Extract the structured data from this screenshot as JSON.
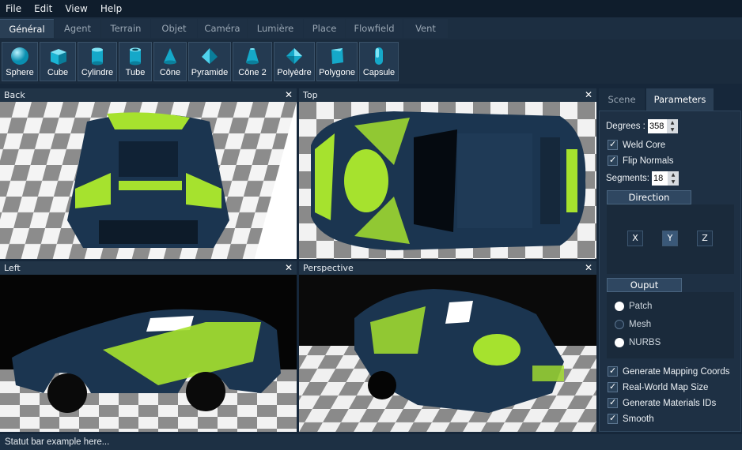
{
  "menu": [
    "File",
    "Edit",
    "View",
    "Help"
  ],
  "tabs": [
    "Général",
    "Agent",
    "Terrain",
    "Objet",
    "Caméra",
    "Lumière",
    "Place",
    "Flowfield",
    "Vent"
  ],
  "active_tab": "Général",
  "toolbar": [
    {
      "label": "Sphere",
      "icon": "sphere-icon"
    },
    {
      "label": "Cube",
      "icon": "cube-icon"
    },
    {
      "label": "Cylindre",
      "icon": "cylinder-icon"
    },
    {
      "label": "Tube",
      "icon": "tube-icon"
    },
    {
      "label": "Cône",
      "icon": "cone-icon"
    },
    {
      "label": "Pyramide",
      "icon": "pyramid-icon"
    },
    {
      "label": "Cône 2",
      "icon": "cone2-icon"
    },
    {
      "label": "Polyèdre",
      "icon": "polyhedron-icon"
    },
    {
      "label": "Polygone",
      "icon": "polygon-icon"
    },
    {
      "label": "Capsule",
      "icon": "capsule-icon"
    }
  ],
  "viewports": [
    {
      "title": "Back",
      "close": "✕"
    },
    {
      "title": "Top",
      "close": "✕"
    },
    {
      "title": "Left",
      "close": "✕"
    },
    {
      "title": "Perspective",
      "close": "✕"
    }
  ],
  "side_tabs": [
    "Scene",
    "Parameters"
  ],
  "active_side_tab": "Parameters",
  "parameters": {
    "degrees_label": "Degrees :",
    "degrees_value": "358",
    "weld_core": {
      "label": "Weld Core",
      "checked": true
    },
    "flip_normals": {
      "label": "Flip Normals",
      "checked": true
    },
    "segments_label": "Segments:",
    "segments_value": "18",
    "direction_label": "Direction",
    "axes": [
      "X",
      "Y",
      "Z"
    ],
    "selected_axis": "Y",
    "output_label": "Ouput",
    "output_options": [
      "Patch",
      "Mesh",
      "NURBS"
    ],
    "options": [
      {
        "label": "Generate Mapping Coords",
        "checked": true
      },
      {
        "label": "Real-World Map Size",
        "checked": true
      },
      {
        "label": "Generate Materials IDs",
        "checked": true
      },
      {
        "label": "Smooth",
        "checked": true
      }
    ]
  },
  "status": "Statut bar example here...",
  "colors": {
    "background": "#16273a",
    "accent": "#3a5878",
    "car_body": "#1b3550",
    "car_livery": "#a6e22e"
  }
}
